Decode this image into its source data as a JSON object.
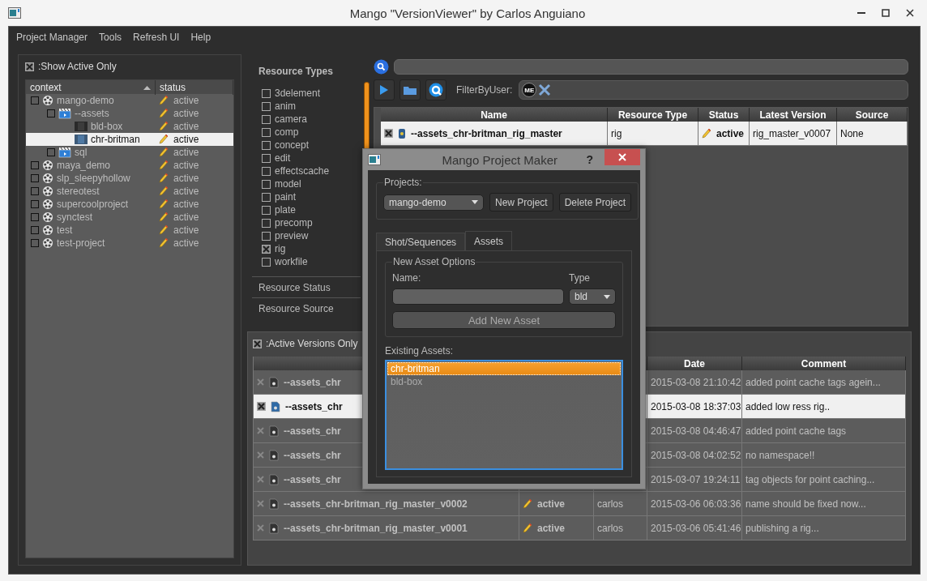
{
  "window": {
    "title": "Mango \"VersionViewer\" by Carlos Anguiano"
  },
  "menu": [
    "Project Manager",
    "Tools",
    "Refresh UI",
    "Help"
  ],
  "left_panel": {
    "show_active_only": {
      "label": ":Show Active Only",
      "checked": true
    },
    "tree": {
      "columns": [
        "context",
        "status"
      ],
      "items": [
        {
          "label": "mango-demo",
          "kind": "project",
          "status": "active",
          "selected": false,
          "children": [
            {
              "label": "--assets",
              "kind": "folder",
              "status": "active",
              "selected": false,
              "children": [
                {
                  "label": "bld-box",
                  "kind": "asset",
                  "status": "active",
                  "selected": false
                },
                {
                  "label": "chr-britman",
                  "kind": "asset",
                  "status": "active",
                  "selected": true
                }
              ]
            },
            {
              "label": "sql",
              "kind": "folder",
              "status": "active",
              "selected": false
            }
          ]
        },
        {
          "label": "maya_demo",
          "kind": "project",
          "status": "active",
          "selected": false
        },
        {
          "label": "slp_sleepyhollow",
          "kind": "project",
          "status": "active",
          "selected": false
        },
        {
          "label": "stereotest",
          "kind": "project",
          "status": "active",
          "selected": false
        },
        {
          "label": "supercoolproject",
          "kind": "project",
          "status": "active",
          "selected": false
        },
        {
          "label": "synctest",
          "kind": "project",
          "status": "active",
          "selected": false
        },
        {
          "label": "test",
          "kind": "project",
          "status": "active",
          "selected": false
        },
        {
          "label": "test-project",
          "kind": "project",
          "status": "active",
          "selected": false
        }
      ]
    }
  },
  "resource_filters": {
    "sections": [
      {
        "title": "Resource Types",
        "expanded": true,
        "items": [
          {
            "label": "3delement",
            "checked": false
          },
          {
            "label": "anim",
            "checked": false
          },
          {
            "label": "camera",
            "checked": false
          },
          {
            "label": "comp",
            "checked": false
          },
          {
            "label": "concept",
            "checked": false
          },
          {
            "label": "edit",
            "checked": false
          },
          {
            "label": "effectscache",
            "checked": false
          },
          {
            "label": "model",
            "checked": false
          },
          {
            "label": "paint",
            "checked": false
          },
          {
            "label": "plate",
            "checked": false
          },
          {
            "label": "precomp",
            "checked": false
          },
          {
            "label": "preview",
            "checked": false
          },
          {
            "label": "rig",
            "checked": true
          },
          {
            "label": "workfile",
            "checked": false
          }
        ]
      },
      {
        "title": "Resource Status",
        "expanded": false
      },
      {
        "title": "Resource Source",
        "expanded": false
      }
    ]
  },
  "toolbar": {
    "filter_label": "FilterByUser:",
    "user_badge": "ME"
  },
  "resource_table": {
    "columns": [
      "Name",
      "Resource Type",
      "Status",
      "Latest Version",
      "Source"
    ],
    "rows": [
      {
        "name": "--assets_chr-britman_rig_master",
        "resource_type": "rig",
        "status": "active",
        "latest_version": "rig_master_v0007",
        "source": "None",
        "selected": true
      }
    ]
  },
  "versions": {
    "active_only": {
      "label": ":Active Versions Only",
      "checked": true
    },
    "columns": [
      "Date",
      "Comment"
    ],
    "rows": [
      {
        "name": "--assets_chr",
        "date": "2015-03-08 21:10:42",
        "comment": "added point cache tags agein...",
        "selected": false
      },
      {
        "name": "--assets_chr",
        "date": "2015-03-08 18:37:03",
        "comment": "added low ress rig..",
        "selected": true
      },
      {
        "name": "--assets_chr",
        "date": "2015-03-08 04:46:47",
        "comment": "added point cache tags",
        "selected": false
      },
      {
        "name": "--assets_chr",
        "date": "2015-03-08 04:02:52",
        "comment": "no namespace!!",
        "selected": false
      },
      {
        "name": "--assets_chr",
        "date": "2015-03-07 19:24:11",
        "comment": "tag objects for point caching...",
        "selected": false
      },
      {
        "name": "--assets_chr-britman_rig_master_v0002",
        "status": "active",
        "user": "carlos",
        "date": "2015-03-06 06:03:36",
        "comment": "name should be fixed now...",
        "selected": false
      },
      {
        "name": "--assets_chr-britman_rig_master_v0001",
        "status": "active",
        "user": "carlos",
        "date": "2015-03-06 05:41:46",
        "comment": "publishing a rig...",
        "selected": false
      }
    ]
  },
  "dialog": {
    "title": "Mango Project Maker",
    "help": "?",
    "projects_label": "Projects:",
    "project": "mango-demo",
    "buttons": [
      "New Project",
      "Delete Project"
    ],
    "tabs": [
      {
        "label": "Shot/Sequences",
        "selected": false
      },
      {
        "label": "Assets",
        "selected": true
      }
    ],
    "new_asset": {
      "title": "New Asset Options",
      "name_label": "Name:",
      "type_label": "Type",
      "type_value": "bld",
      "add_button": "Add New Asset"
    },
    "existing_label": "Existing Assets:",
    "existing": [
      {
        "label": "chr-britman",
        "selected": true
      },
      {
        "label": "bld-box",
        "selected": false
      }
    ]
  }
}
